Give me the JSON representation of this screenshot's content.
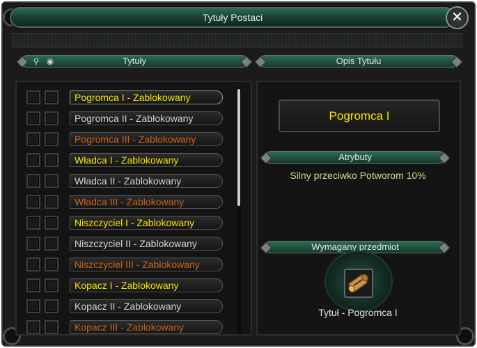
{
  "window": {
    "title": "Tytuły Postaci",
    "close_glyph": "✕"
  },
  "left_panel": {
    "header": "Tytuły",
    "icons": [
      "magnifier-icon",
      "eye-icon"
    ],
    "search_glyph": "⚲",
    "eye_glyph": "◉",
    "titles": [
      {
        "label": "Pogromca I - Zablokowany",
        "color": "yellow",
        "selected": true
      },
      {
        "label": "Pogromca II - Zablokowany",
        "color": "white",
        "selected": false
      },
      {
        "label": "Pogromca III - Zablokowany",
        "color": "orange",
        "selected": false
      },
      {
        "label": "Władca I - Zablokowany",
        "color": "yellow",
        "selected": false
      },
      {
        "label": "Władca II - Zablokowany",
        "color": "white",
        "selected": false
      },
      {
        "label": "Władca III - Zablokowany",
        "color": "orange",
        "selected": false
      },
      {
        "label": "Niszczyciel I - Zablokowany",
        "color": "yellow",
        "selected": false
      },
      {
        "label": "Niszczyciel II - Zablokowany",
        "color": "white",
        "selected": false
      },
      {
        "label": "Niszczyciel III - Zablokowany",
        "color": "orange",
        "selected": false
      },
      {
        "label": "Kopacz I - Zablokowany",
        "color": "yellow",
        "selected": false
      },
      {
        "label": "Kopacz II - Zablokowany",
        "color": "white",
        "selected": false
      },
      {
        "label": "Kopacz III - Zablokowany",
        "color": "orange",
        "selected": false
      }
    ]
  },
  "right_panel": {
    "header": "Opis Tytułu",
    "selected_title": "Pogromca I",
    "attributes_header": "Atrybuty",
    "attribute_text": "Silny przeciwko Potworom 10%",
    "required_item_header": "Wymagany przedmiot",
    "required_item_name": "Tytuł - Pogromca I",
    "required_item_icon": "scroll-icon"
  },
  "colors": {
    "yellow": "#f6e400",
    "white": "#d2d2d2",
    "orange": "#c9621a",
    "header_green": "#2e6a51",
    "attribute_green": "#c5e08b"
  }
}
